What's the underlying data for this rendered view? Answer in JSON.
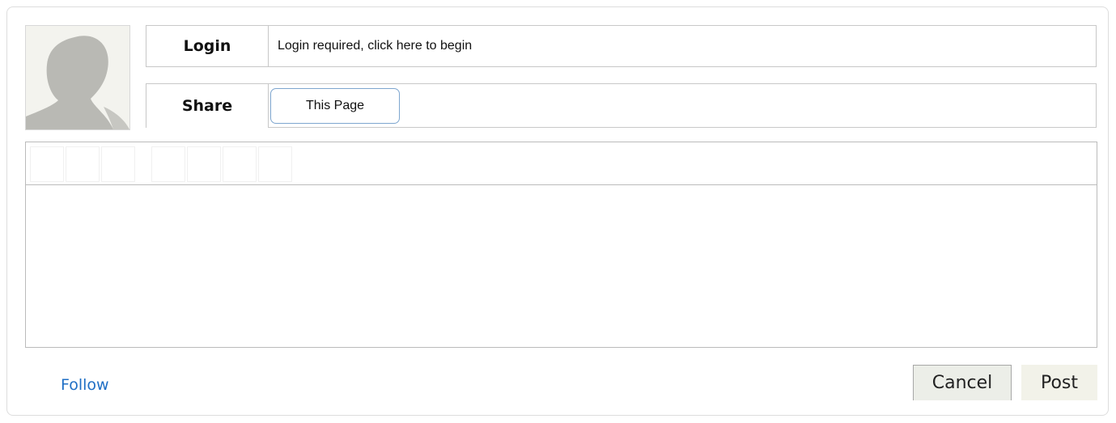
{
  "login": {
    "label": "Login",
    "value": "Login required, click here to begin"
  },
  "share": {
    "label": "Share",
    "button_label": "This Page"
  },
  "avatar": {
    "icon": "user-silhouette-icon"
  },
  "editor": {
    "toolbar_buttons": [
      "tool-1",
      "tool-2",
      "tool-3",
      "tool-4",
      "tool-5",
      "tool-6",
      "tool-7"
    ],
    "body_value": ""
  },
  "footer": {
    "follow_label": "Follow",
    "cancel_label": "Cancel",
    "post_label": "Post"
  },
  "colors": {
    "link": "#1f6fc5",
    "border": "#c8c8c8",
    "button_bg": "#eceee8"
  }
}
